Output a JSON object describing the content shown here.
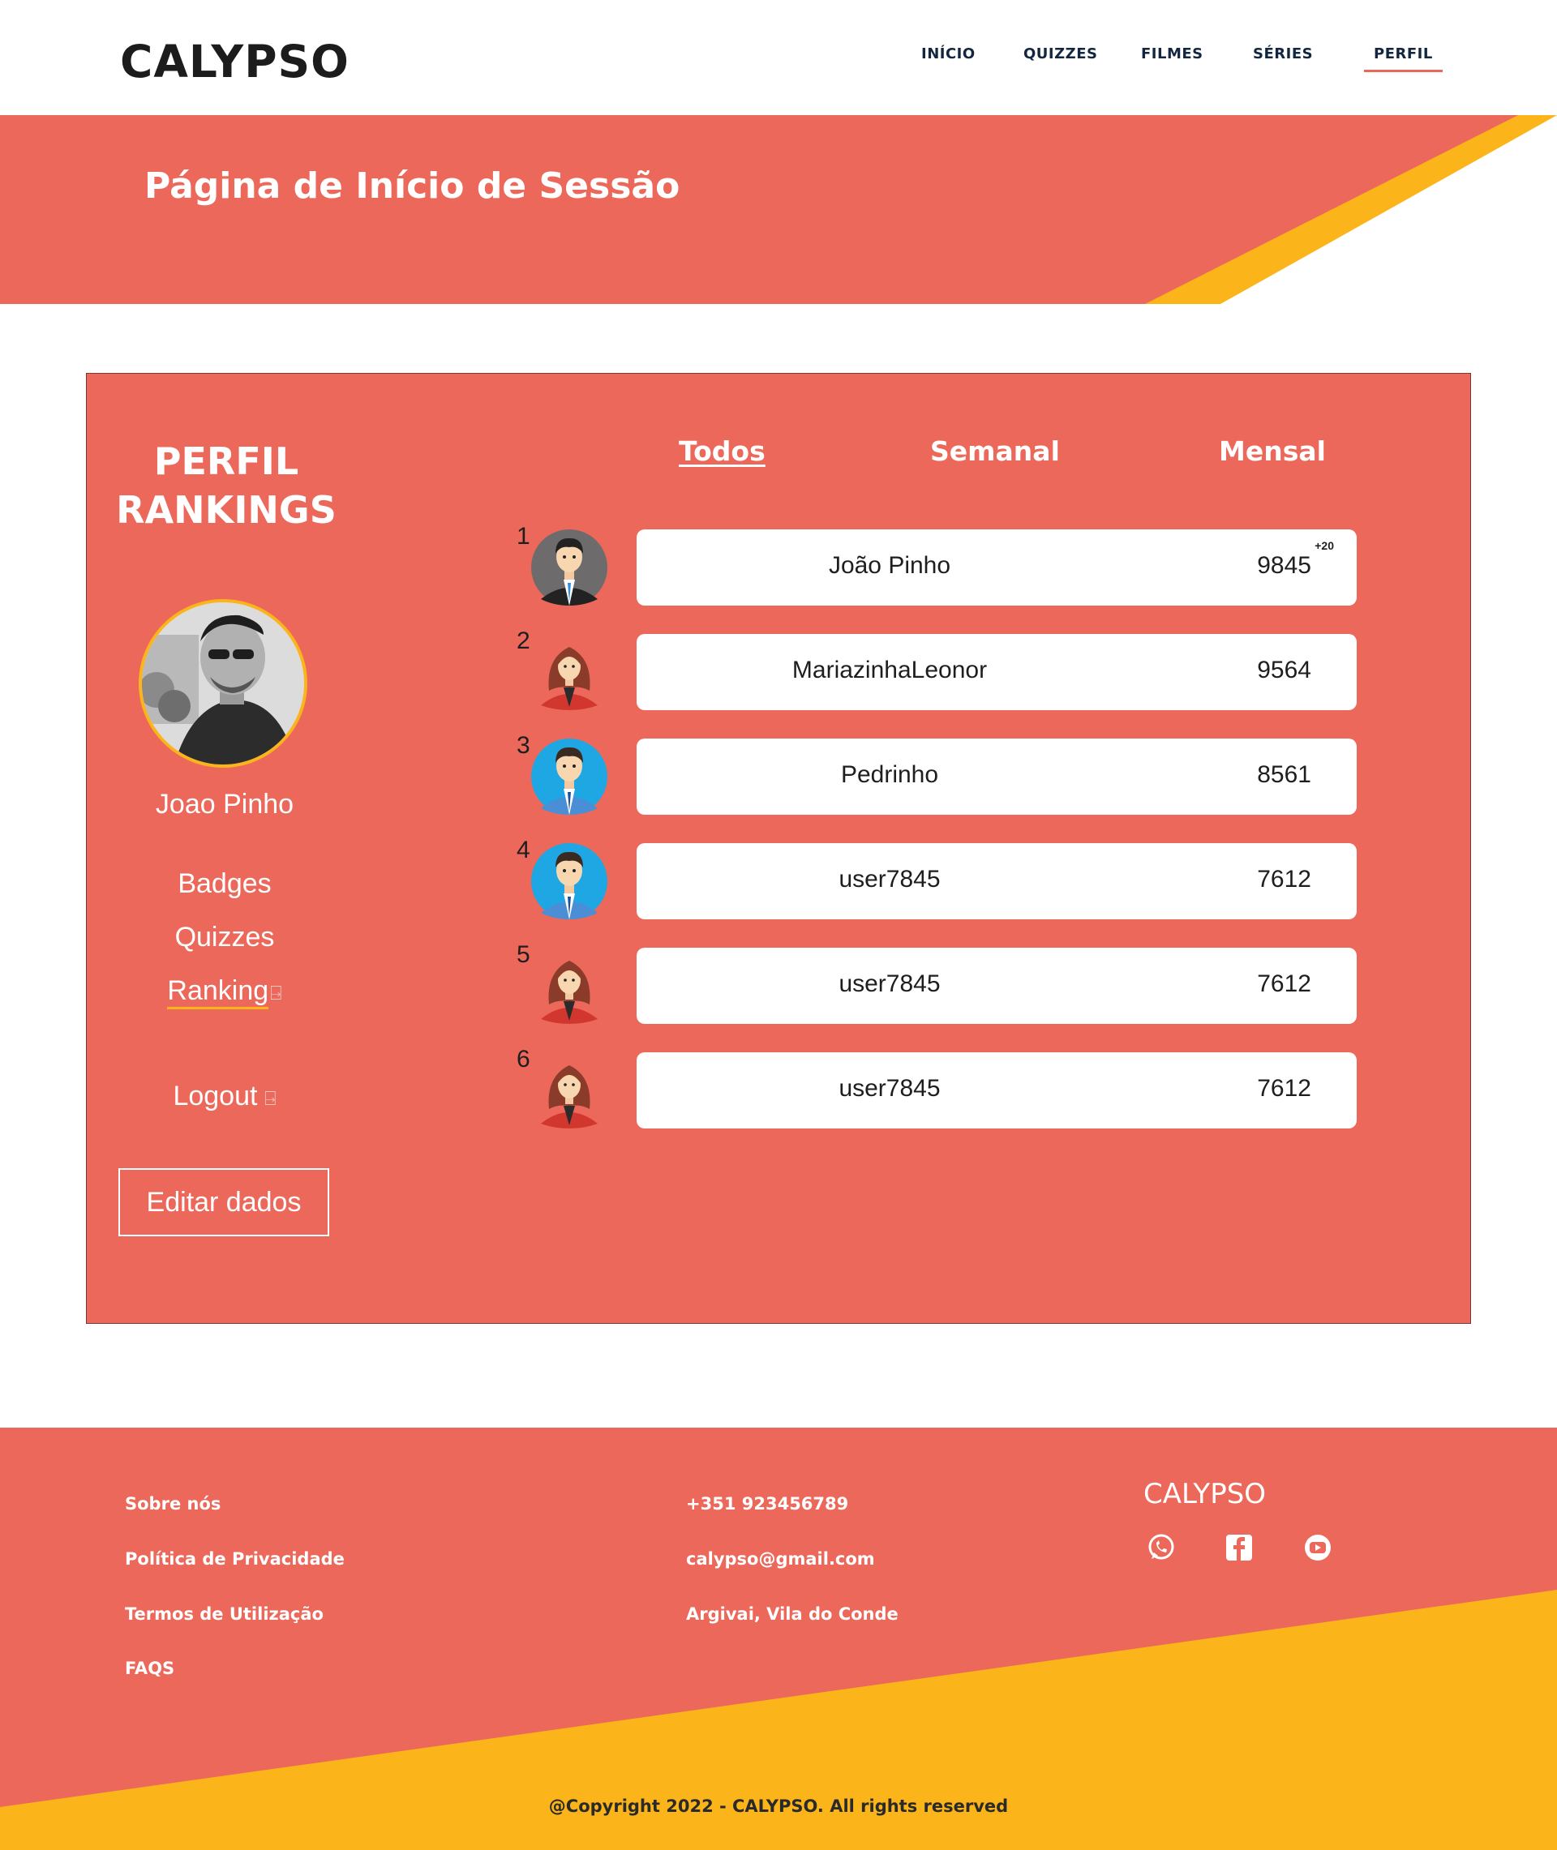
{
  "header": {
    "logo": "CALYPSO",
    "nav": [
      "INÍCIO",
      "QUIZZES",
      "FILMES",
      "SÉRIES",
      "PERFIL"
    ],
    "active_nav": "PERFIL"
  },
  "banner": {
    "title": "Página de Início de Sessão"
  },
  "profile": {
    "title_line1": "PERFIL",
    "title_line2": "RANKINGS",
    "username": "Joao Pinho",
    "menu": {
      "badges": "Badges",
      "quizzes": "Quizzes",
      "ranking": "Ranking",
      "logout": "Logout"
    },
    "edit_button": "Editar dados"
  },
  "tabs": [
    "Todos",
    "Semanal",
    "Mensal"
  ],
  "active_tab": "Todos",
  "rankings": [
    {
      "rank": "1",
      "name": "João Pinho",
      "score": "9845",
      "badge": "+20",
      "avatar": "man-suit-icon"
    },
    {
      "rank": "2",
      "name": "MariazinhaLeonor",
      "score": "9564",
      "badge": "",
      "avatar": "woman-icon"
    },
    {
      "rank": "3",
      "name": "Pedrinho",
      "score": "8561",
      "badge": "",
      "avatar": "man-blue-icon"
    },
    {
      "rank": "4",
      "name": "user7845",
      "score": "7612",
      "badge": "",
      "avatar": "man-blue-icon"
    },
    {
      "rank": "5",
      "name": "user7845",
      "score": "7612",
      "badge": "",
      "avatar": "woman-icon"
    },
    {
      "rank": "6",
      "name": "user7845",
      "score": "7612",
      "badge": "",
      "avatar": "woman-icon"
    }
  ],
  "footer": {
    "links": {
      "about": "Sobre nós",
      "privacy": "Política de Privacidade",
      "terms": "Termos de Utilização",
      "faqs": "FAQS"
    },
    "contact": {
      "phone": "+351 923456789",
      "email": "calypso@gmail.com",
      "address": "Argivai, Vila do Conde"
    },
    "brand": "CALYPSO",
    "social": [
      "whatsapp-icon",
      "facebook-icon",
      "youtube-icon"
    ],
    "copyright": "@Copyright 2022 - CALYPSO. All rights reserved"
  },
  "colors": {
    "coral": "#ec685a",
    "yellow": "#fbb41a",
    "navy": "#12273f"
  }
}
